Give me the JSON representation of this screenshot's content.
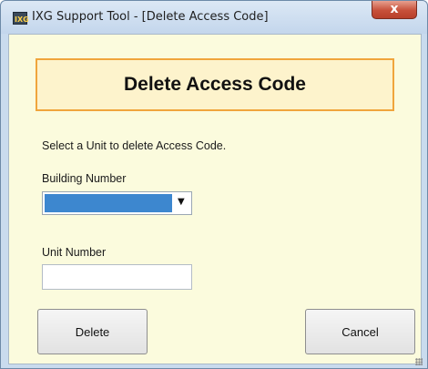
{
  "window": {
    "title": "IXG Support Tool - [Delete Access Code]",
    "app_icon_text": "IXG",
    "close_glyph": "x"
  },
  "dialog": {
    "header_title": "Delete Access Code",
    "instruction": "Select a Unit to delete Access Code.",
    "building_label": "Building Number",
    "building_selected": "",
    "building_dropdown_glyph": "▼",
    "unit_label": "Unit Number",
    "unit_value": "",
    "delete_label": "Delete",
    "cancel_label": "Cancel"
  },
  "colors": {
    "client_bg": "#fbfbdd",
    "header_border": "#f0a53c",
    "selection_blue": "#3d87cf",
    "close_red": "#c7503a"
  }
}
